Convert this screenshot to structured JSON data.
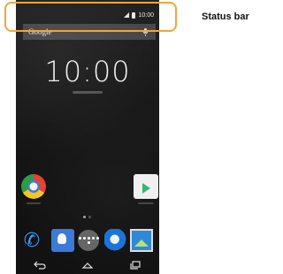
{
  "status_bar": {
    "time": "10:00",
    "icons": [
      "signal-icon",
      "battery-icon"
    ]
  },
  "search": {
    "brand": "Google",
    "icon": "mic-icon"
  },
  "home": {
    "clock": "10:00",
    "apps": [
      "chrome-icon",
      "play-store-icon"
    ],
    "dock": [
      "phone-icon",
      "contacts-icon",
      "apps-drawer-icon",
      "browser-icon",
      "gallery-icon"
    ]
  },
  "nav": [
    "back-icon",
    "home-icon",
    "recents-icon"
  ],
  "annotation": {
    "label": "Status bar",
    "highlight_color": "#f0a63a"
  }
}
